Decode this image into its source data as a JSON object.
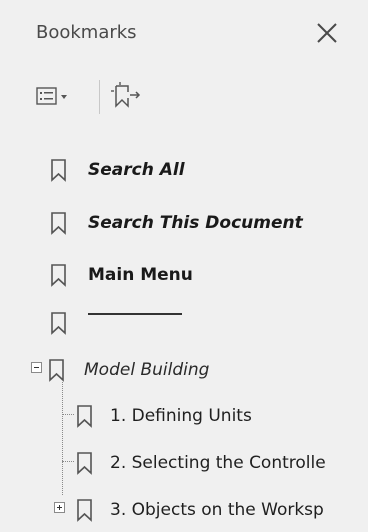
{
  "panel": {
    "title": "Bookmarks",
    "close_icon": "close-icon"
  },
  "toolbar": {
    "options_icon": "list-options-icon",
    "new_bookmark_icon": "new-bookmark-icon"
  },
  "bookmarks": [
    {
      "label": "Search All",
      "style": "bold-italic"
    },
    {
      "label": "Search This Document",
      "style": "bold-italic"
    },
    {
      "label": "Main Menu",
      "style": "bold"
    },
    {
      "label": "",
      "style": "separator"
    },
    {
      "label": "Model Building",
      "style": "italic",
      "expanded": true
    },
    {
      "label": "1. Defining Units",
      "style": "plain"
    },
    {
      "label": "2. Selecting the Controlle",
      "style": "plain"
    },
    {
      "label": "3. Objects on the Worksp",
      "style": "plain",
      "expanded": false
    }
  ],
  "colors": {
    "background": "#f0f0f0",
    "icon": "#555555",
    "text": "#1a1a1a"
  }
}
